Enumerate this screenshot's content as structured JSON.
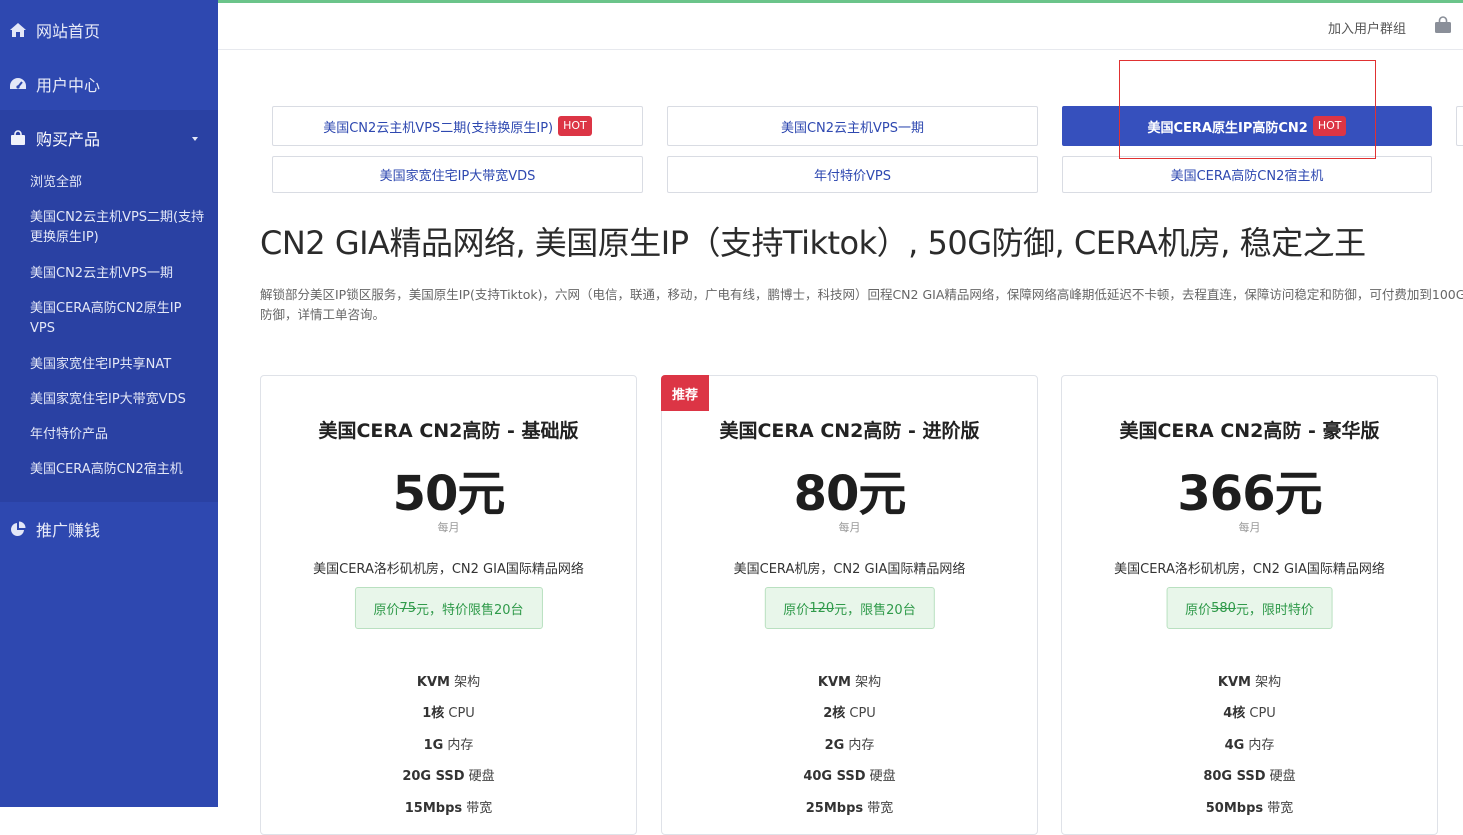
{
  "sidebar": {
    "home": "网站首页",
    "user_center": "用户中心",
    "buy": "购买产品",
    "sub_items": [
      "浏览全部",
      "美国CN2云主机VPS二期(支持更换原生IP)",
      "美国CN2云主机VPS一期",
      "美国CERA高防CN2原生IP VPS",
      "美国家宽住宅IP共享NAT",
      "美国家宽住宅IP大带宽VDS",
      "年付特价产品",
      "美国CERA高防CN2宿主机"
    ],
    "affiliate": "推广赚钱"
  },
  "topbar": {
    "join_group": "加入用户群组"
  },
  "tabs": [
    {
      "label": "美国CN2云主机VPS二期(支持换原生IP)",
      "hot": "HOT"
    },
    {
      "label": "美国CN2云主机VPS一期"
    },
    {
      "label": "美国CERA原生IP高防CN2",
      "hot": "HOT"
    },
    {
      "label": "美国家宽住宅IP大带宽VDS"
    },
    {
      "label": "年付特价VPS"
    },
    {
      "label": "美国CERA高防CN2宿主机"
    }
  ],
  "headline": "CN2 GIA精品网络, 美国原生IP（支持Tiktok）, 50G防御, CERA机房, 稳定之王",
  "description": "解锁部分美区IP锁区服务，美国原生IP(支持Tiktok)，六网（电信，联通，移动，广电有线，鹏博士，科技网）回程CN2 GIA精品网络，保障网络高峰期低延迟不卡顿，去程直连，保障访问稳定和防御，可付费加到100G防御，详情工单咨询。",
  "products": [
    {
      "title": "美国CERA CN2高防 - 基础版",
      "price": "50元",
      "period": "每月",
      "location": "美国CERA洛杉矶机房，CN2 GIA国际精品网络",
      "promo_prefix": "原价",
      "promo_strike": "75",
      "promo_suffix": "元，特价限售20台",
      "specs": [
        {
          "bold": "KVM",
          "text": " 架构"
        },
        {
          "bold": "1核",
          "text": " CPU"
        },
        {
          "bold": "1G",
          "text": " 内存"
        },
        {
          "bold": "20G SSD",
          "text": " 硬盘"
        },
        {
          "bold": "15Mbps",
          "text": " 带宽"
        }
      ]
    },
    {
      "badge": "推荐",
      "title": "美国CERA CN2高防 - 进阶版",
      "price": "80元",
      "period": "每月",
      "location": "美国CERA机房，CN2 GIA国际精品网络",
      "promo_prefix": "原价",
      "promo_strike": "120",
      "promo_suffix": "元，限售20台",
      "specs": [
        {
          "bold": "KVM",
          "text": " 架构"
        },
        {
          "bold": "2核",
          "text": " CPU"
        },
        {
          "bold": "2G",
          "text": " 内存"
        },
        {
          "bold": "40G SSD",
          "text": " 硬盘"
        },
        {
          "bold": "25Mbps",
          "text": " 带宽"
        }
      ]
    },
    {
      "title": "美国CERA CN2高防 - 豪华版",
      "price": "366元",
      "period": "每月",
      "location": "美国CERA洛杉矶机房，CN2 GIA国际精品网络",
      "promo_prefix": "原价",
      "promo_strike": "580",
      "promo_suffix": "元，限时特价",
      "specs": [
        {
          "bold": "KVM",
          "text": " 架构"
        },
        {
          "bold": "4核",
          "text": " CPU"
        },
        {
          "bold": "4G",
          "text": " 内存"
        },
        {
          "bold": "80G SSD",
          "text": " 硬盘"
        },
        {
          "bold": "50Mbps",
          "text": " 带宽"
        }
      ]
    }
  ],
  "colors": {
    "sidebar": "#2e48b0",
    "accent": "#3650bd",
    "hot": "#dc3545",
    "promo": "#2f9a4a"
  }
}
